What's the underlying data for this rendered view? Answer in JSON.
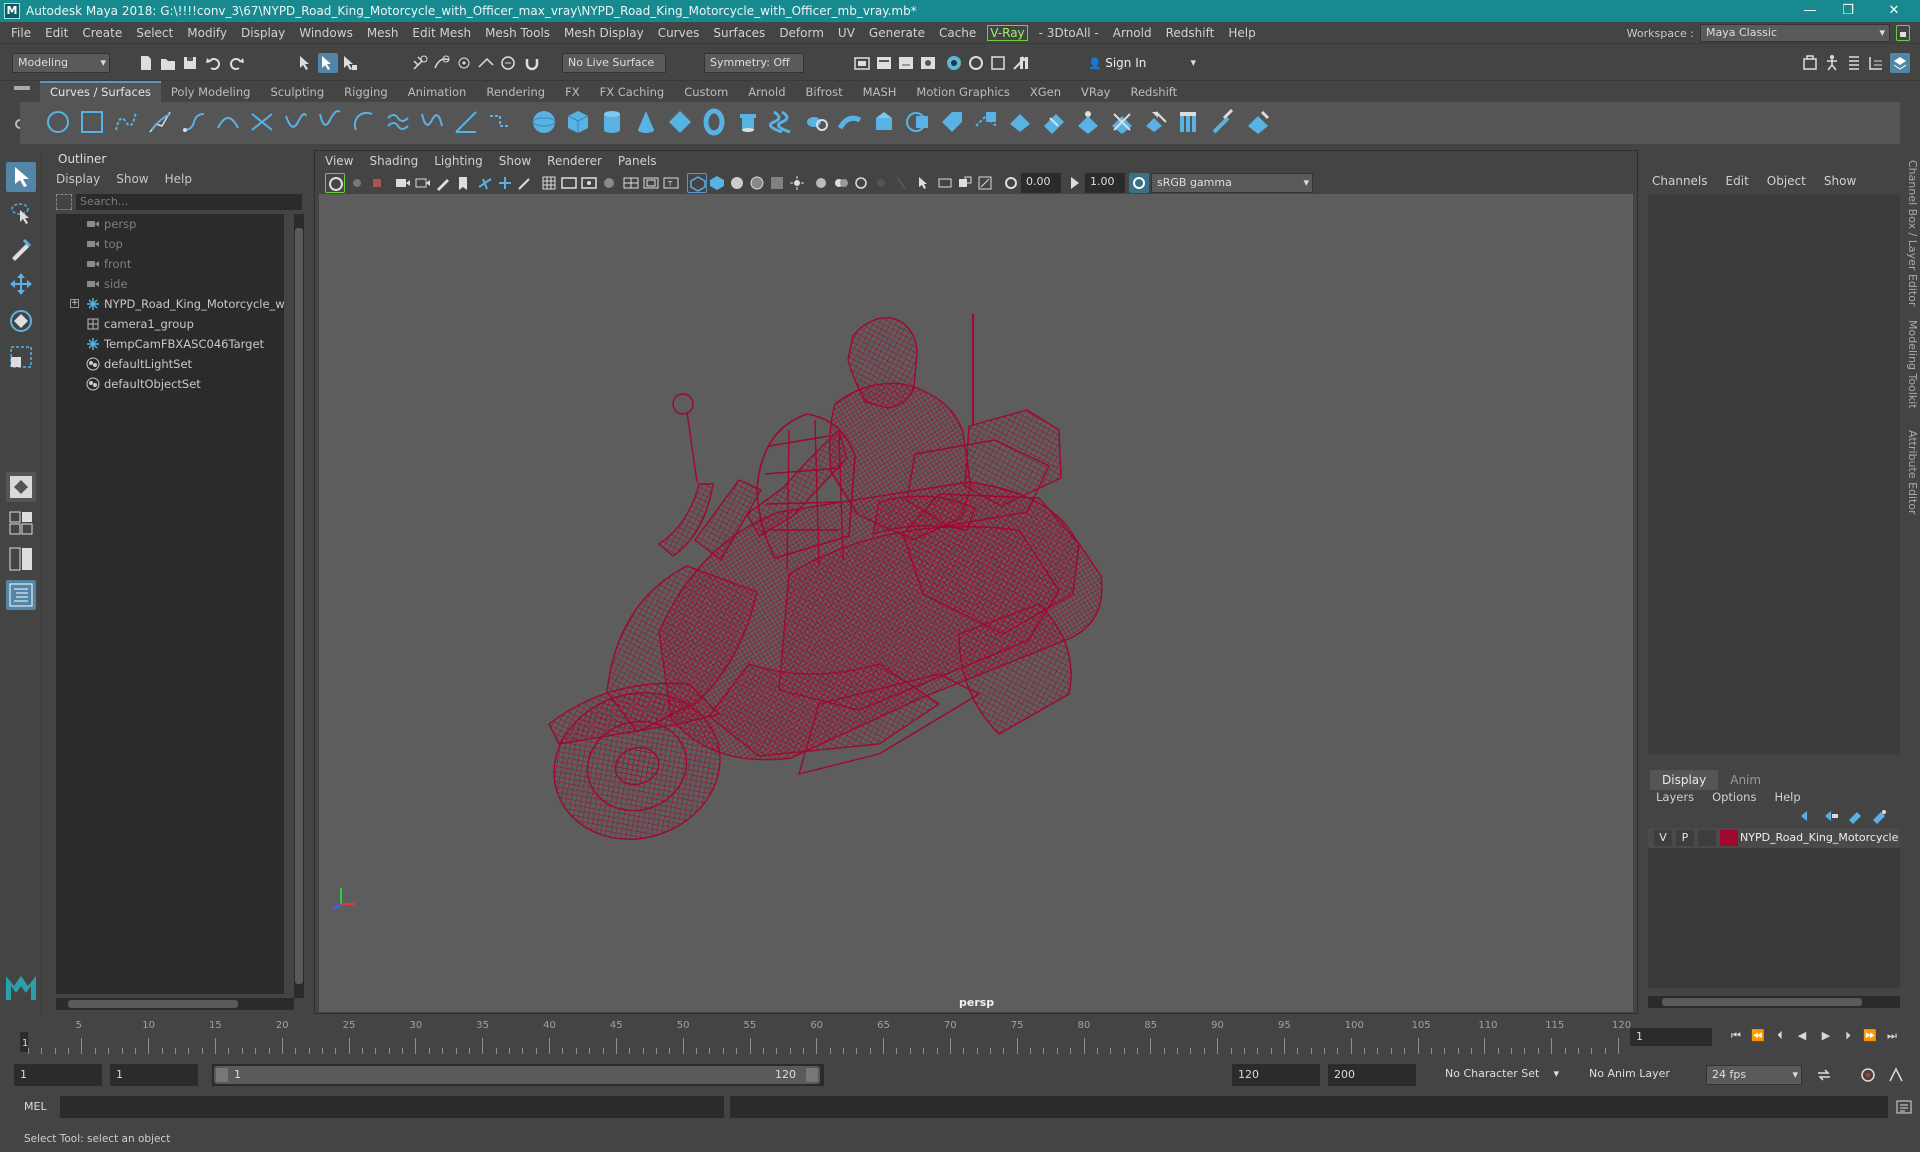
{
  "window": {
    "title": "Autodesk Maya 2018: G:\\!!!!conv_3\\67\\NYPD_Road_King_Motorcycle_with_Officer_max_vray\\NYPD_Road_King_Motorcycle_with_Officer_mb_vray.mb*",
    "minimize": "—",
    "restore": "❐",
    "close": "✕"
  },
  "menubar": {
    "items": [
      "File",
      "Edit",
      "Create",
      "Select",
      "Modify",
      "Display",
      "Windows",
      "Mesh",
      "Edit Mesh",
      "Mesh Tools",
      "Mesh Display",
      "Curves",
      "Surfaces",
      "Deform",
      "UV",
      "Generate",
      "Cache"
    ],
    "vray": "V-Ray",
    "items2": [
      "- 3DtoAll -",
      "Arnold",
      "Redshift",
      "Help"
    ],
    "workspace_label": "Workspace :",
    "workspace_value": "Maya Classic"
  },
  "statusline": {
    "mode": "Modeling",
    "live_surface": "No Live Surface",
    "symmetry": "Symmetry: Off",
    "sign_in": "Sign In"
  },
  "shelf": {
    "tabs": [
      "Curves / Surfaces",
      "Poly Modeling",
      "Sculpting",
      "Rigging",
      "Animation",
      "Rendering",
      "FX",
      "FX Caching",
      "Custom",
      "Arnold",
      "Bifrost",
      "MASH",
      "Motion Graphics",
      "XGen",
      "VRay",
      "Redshift"
    ],
    "active": "Curves / Surfaces"
  },
  "outliner": {
    "title": "Outliner",
    "menu": [
      "Display",
      "Show",
      "Help"
    ],
    "search_placeholder": "Search...",
    "items": [
      {
        "name": "persp",
        "kind": "camera"
      },
      {
        "name": "top",
        "kind": "camera"
      },
      {
        "name": "front",
        "kind": "camera"
      },
      {
        "name": "side",
        "kind": "camera"
      },
      {
        "name": "NYPD_Road_King_Motorcycle_with_O",
        "kind": "group"
      },
      {
        "name": "camera1_group",
        "kind": "camgroup"
      },
      {
        "name": "TempCamFBXASC046Target",
        "kind": "target"
      },
      {
        "name": "defaultLightSet",
        "kind": "set"
      },
      {
        "name": "defaultObjectSet",
        "kind": "set"
      }
    ]
  },
  "viewport": {
    "menu": [
      "View",
      "Shading",
      "Lighting",
      "Show",
      "Renderer",
      "Panels"
    ],
    "exposure": "0.00",
    "gamma": "1.00",
    "color_space": "sRGB gamma",
    "camera_label": "persp",
    "wire_color": "#a0082e"
  },
  "channelbox": {
    "menu": [
      "Channels",
      "Edit",
      "Object",
      "Show"
    ]
  },
  "layers": {
    "tabs": [
      "Display",
      "Anim"
    ],
    "active": "Display",
    "menu": [
      "Layers",
      "Options",
      "Help"
    ],
    "row": {
      "v": "V",
      "p": "P",
      "name": "NYPD_Road_King_Motorcycle_w",
      "color": "#a0082e"
    }
  },
  "side_tabs": [
    "Channel Box / Layer Editor",
    "Modeling Toolkit",
    "Attribute Editor"
  ],
  "timeslider": {
    "ticks": [
      "5",
      "10",
      "15",
      "20",
      "25",
      "30",
      "35",
      "40",
      "45",
      "50",
      "55",
      "60",
      "65",
      "70",
      "75",
      "80",
      "85",
      "90",
      "95",
      "100",
      "105",
      "110",
      "115",
      "120"
    ],
    "start_marker": "1",
    "current_frame": "1"
  },
  "range": {
    "start": "1",
    "anim_start": "1",
    "range_start": "1",
    "range_end": "120",
    "end": "120",
    "anim_end": "200",
    "character_set": "No Character Set",
    "anim_layer": "No Anim Layer",
    "fps": "24 fps"
  },
  "command": {
    "label": "MEL"
  },
  "help_line": "Select Tool: select an object"
}
